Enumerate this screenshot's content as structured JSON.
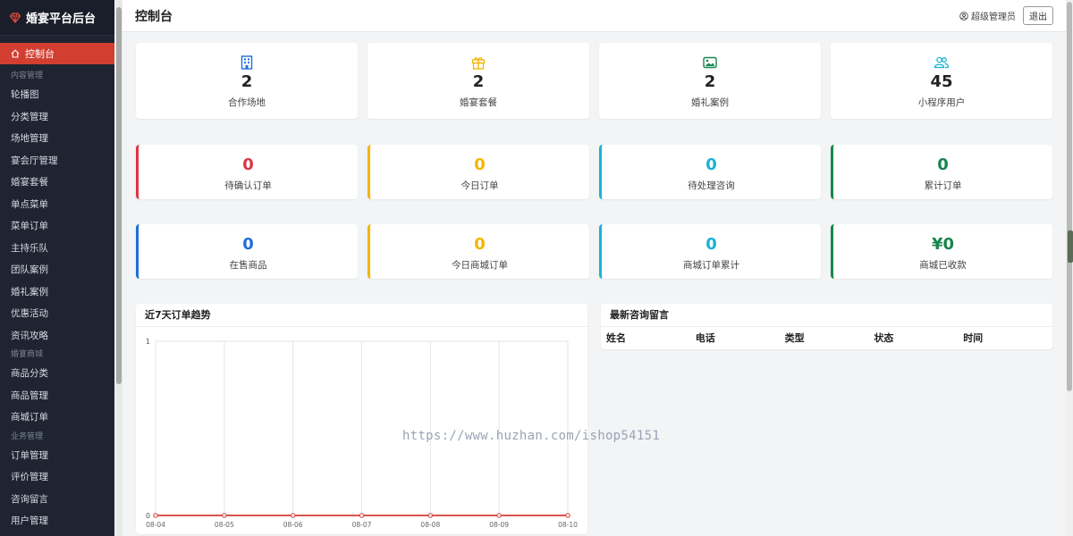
{
  "app": {
    "brand": "婚宴平台后台"
  },
  "sidebar": {
    "active": "控制台",
    "group1": "内容管理",
    "items1": [
      "轮播图",
      "分类管理",
      "场地管理",
      "宴会厅管理",
      "婚宴套餐",
      "单点菜单",
      "菜单订单",
      "主持乐队",
      "团队案例",
      "婚礼案例",
      "优惠活动",
      "资讯攻略"
    ],
    "group2": "婚宴商城",
    "items2": [
      "商品分类",
      "商品管理",
      "商城订单"
    ],
    "group3": "业务管理",
    "items3": [
      "订单管理",
      "评价管理",
      "咨询留言",
      "用户管理"
    ]
  },
  "header": {
    "title": "控制台",
    "user": "超级管理员",
    "logout": "退出"
  },
  "row1": [
    {
      "value": "2",
      "label": "合作场地",
      "icon": "building-icon",
      "color": "#1e6fd9"
    },
    {
      "value": "2",
      "label": "婚宴套餐",
      "icon": "gift-icon",
      "color": "#f5b400"
    },
    {
      "value": "2",
      "label": "婚礼案例",
      "icon": "image-icon",
      "color": "#17864d"
    },
    {
      "value": "45",
      "label": "小程序用户",
      "icon": "users-icon",
      "color": "#17b3d6"
    }
  ],
  "row2": [
    {
      "value": "0",
      "label": "待确认订单",
      "color": "#dc3545"
    },
    {
      "value": "0",
      "label": "今日订单",
      "color": "#f5b400"
    },
    {
      "value": "0",
      "label": "待处理咨询",
      "color": "#17b3d6"
    },
    {
      "value": "0",
      "label": "累计订单",
      "color": "#17864d"
    }
  ],
  "row3": [
    {
      "value": "0",
      "label": "在售商品",
      "color": "#1e6fd9"
    },
    {
      "value": "0",
      "label": "今日商城订单",
      "color": "#f5b400"
    },
    {
      "value": "0",
      "label": "商城订单累计",
      "color": "#17b3d6"
    },
    {
      "value": "¥0",
      "label": "商城已收款",
      "color": "#17864d"
    }
  ],
  "trend": {
    "title": "近7天订单趋势"
  },
  "consult": {
    "title": "最新咨询留言",
    "columns": [
      "姓名",
      "电话",
      "类型",
      "状态",
      "时间"
    ]
  },
  "watermark": "https://www.huzhan.com/ishop54151",
  "chart_data": {
    "type": "line",
    "x": [
      "08-04",
      "08-05",
      "08-06",
      "08-07",
      "08-08",
      "08-09",
      "08-10"
    ],
    "series": [
      {
        "values": [
          0,
          0,
          0,
          0,
          0,
          0,
          0
        ],
        "color": "#d9534f"
      }
    ],
    "ylim": [
      0,
      1
    ],
    "yticks": [
      "0",
      "1"
    ],
    "grid": true
  }
}
